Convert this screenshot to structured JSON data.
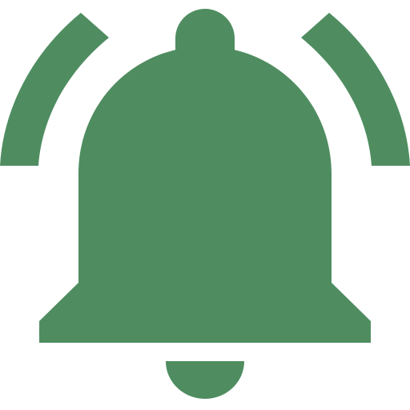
{
  "icon": {
    "name": "bell-ringing-icon",
    "color": "#4F8D61",
    "background": "#FFFFFF"
  }
}
